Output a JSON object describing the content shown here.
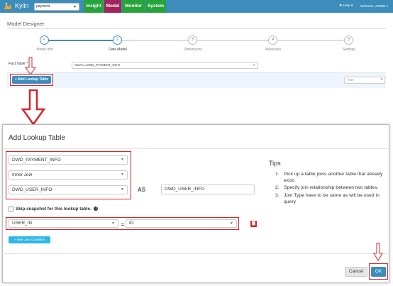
{
  "nav": {
    "brand": "Kylin",
    "project_select": "payment",
    "tabs": [
      "Insight",
      "Model",
      "Monitor",
      "System"
    ],
    "help": "Help",
    "welcome": "Welcome, ADMIN"
  },
  "designer": {
    "title": "Model Designer",
    "steps": [
      {
        "num": "✓",
        "label": "Model Info"
      },
      {
        "num": "2",
        "label": "Data Model"
      },
      {
        "num": "3",
        "label": "Dimensions"
      },
      {
        "num": "4",
        "label": "Measures"
      },
      {
        "num": "5",
        "label": "Settings"
      }
    ],
    "fact_table_label": "Fact Table *",
    "fact_table_value": "GMALL.DWD_PAYMENT_INFO",
    "add_lookup_label": "+ Add Lookup Table",
    "filter_placeholder": "Filter"
  },
  "modal": {
    "title": "Add Lookup Table",
    "left_table": "DWD_PAYMENT_INFO",
    "join_type": "Inner Join",
    "lookup_table": "DWD_USER_INFO",
    "as_label": "AS",
    "alias": "DWD_USER_INFO",
    "skip_snapshot_label": "Skip snapshot for this lookup table.",
    "join_left_column": "USER_ID",
    "eq": "=",
    "join_right_column": "ID",
    "new_join_label": "+ New Join Condition",
    "tips_title": "Tips",
    "tips": [
      {
        "num": "1.",
        "text": "Pick up a table joins another table that already exist."
      },
      {
        "num": "2.",
        "text": "Specify join relationship between two tables."
      },
      {
        "num": "3.",
        "text": "Join Type have to be same as will be used in query"
      }
    ],
    "cancel": "Cancel",
    "ok": "OK"
  },
  "colors": {
    "nav_blue": "#3c8dbc",
    "insight_green": "#27a33c",
    "model_magenta": "#a1245a",
    "highlight_red": "#d9232a"
  }
}
